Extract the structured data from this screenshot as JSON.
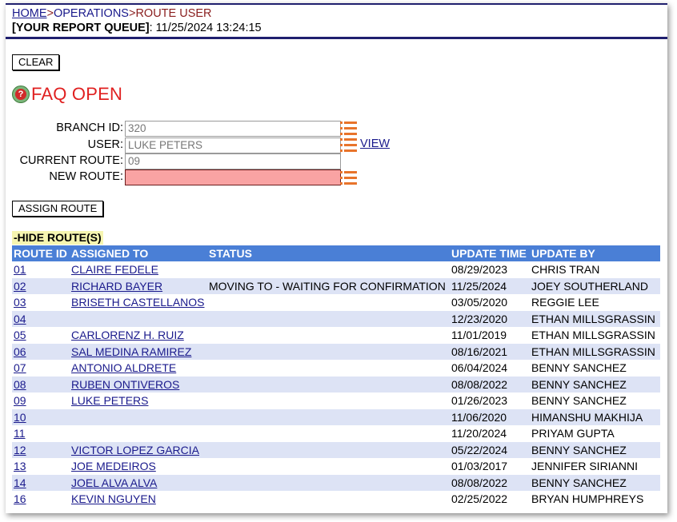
{
  "breadcrumb": {
    "home": "HOME",
    "sep": ">",
    "operations": "OPERATIONS",
    "current": "ROUTE USER"
  },
  "report_queue": {
    "label": "[YOUR REPORT QUEUE]",
    "timestamp": ": 11/25/2024 13:24:15"
  },
  "buttons": {
    "clear": "CLEAR",
    "assign": "ASSIGN ROUTE"
  },
  "faq": {
    "label": "FAQ OPEN",
    "icon": "help-question-icon"
  },
  "form": {
    "branch_label": "BRANCH ID:",
    "branch_value": "320",
    "user_label": "USER:",
    "user_value": "LUKE PETERS",
    "current_label": "CURRENT ROUTE:",
    "current_value": "09",
    "new_label": "NEW ROUTE:",
    "new_value": "",
    "view_link": "VIEW"
  },
  "colors": {
    "accent_blue": "#4a7fd6",
    "required_field": "#f9a3a3",
    "faq_red": "#e02020",
    "list_icon": "#e8742b"
  },
  "hide_routes": "-HIDE ROUTE(S)",
  "table": {
    "headers": [
      "ROUTE ID",
      "ASSIGNED TO",
      "STATUS",
      "UPDATE TIME",
      "UPDATE BY"
    ],
    "rows": [
      {
        "id": "01",
        "assigned": "CLAIRE FEDELE",
        "status": "",
        "time": "08/29/2023",
        "by": "CHRIS TRAN"
      },
      {
        "id": "02",
        "assigned": "RICHARD BAYER",
        "status": "MOVING TO - WAITING FOR CONFIRMATION",
        "time": "11/25/2024",
        "by": "JOEY SOUTHERLAND"
      },
      {
        "id": "03",
        "assigned": "BRISETH CASTELLANOS",
        "status": "",
        "time": "03/05/2020",
        "by": "REGGIE LEE"
      },
      {
        "id": "04",
        "assigned": "",
        "status": "",
        "time": "12/23/2020",
        "by": "ETHAN MILLSGRASSIN"
      },
      {
        "id": "05",
        "assigned": "CARLORENZ H. RUIZ",
        "status": "",
        "time": "11/01/2019",
        "by": "ETHAN MILLSGRASSIN"
      },
      {
        "id": "06",
        "assigned": "SAL MEDINA RAMIREZ",
        "status": "",
        "time": "08/16/2021",
        "by": "ETHAN MILLSGRASSIN"
      },
      {
        "id": "07",
        "assigned": "ANTONIO ALDRETE",
        "status": "",
        "time": "06/04/2024",
        "by": "BENNY SANCHEZ"
      },
      {
        "id": "08",
        "assigned": "RUBEN ONTIVEROS",
        "status": "",
        "time": "08/08/2022",
        "by": "BENNY SANCHEZ"
      },
      {
        "id": "09",
        "assigned": "LUKE PETERS",
        "status": "",
        "time": "01/26/2023",
        "by": "BENNY SANCHEZ"
      },
      {
        "id": "10",
        "assigned": "",
        "status": "",
        "time": "11/06/2020",
        "by": "HIMANSHU MAKHIJA"
      },
      {
        "id": "11",
        "assigned": "",
        "status": "",
        "time": "11/20/2024",
        "by": "PRIYAM GUPTA"
      },
      {
        "id": "12",
        "assigned": "VICTOR LOPEZ GARCIA",
        "status": "",
        "time": "05/22/2024",
        "by": "BENNY SANCHEZ"
      },
      {
        "id": "13",
        "assigned": "JOE MEDEIROS",
        "status": "",
        "time": "01/03/2017",
        "by": "JENNIFER SIRIANNI"
      },
      {
        "id": "14",
        "assigned": "JOEL ALVA ALVA",
        "status": "",
        "time": "08/08/2022",
        "by": "BENNY SANCHEZ"
      },
      {
        "id": "16",
        "assigned": "KEVIN NGUYEN",
        "status": "",
        "time": "02/25/2022",
        "by": "BRYAN HUMPHREYS"
      }
    ]
  }
}
